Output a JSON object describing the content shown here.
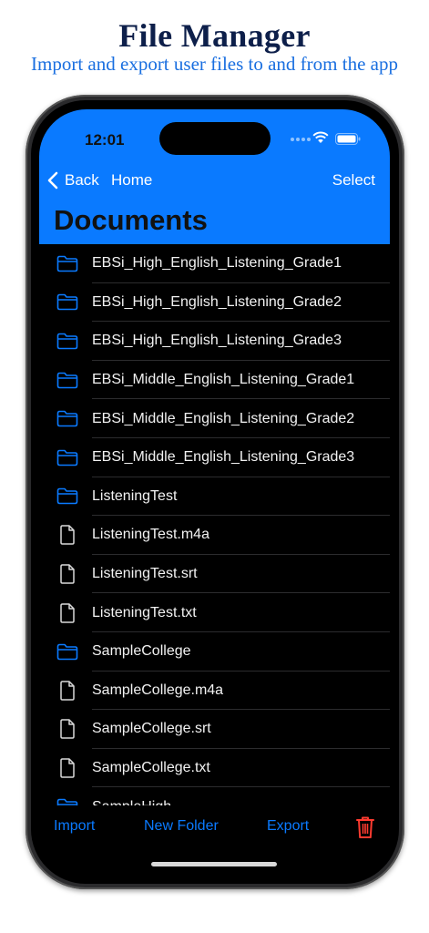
{
  "promo": {
    "title": "File Manager",
    "subtitle": "Import and export user files to and from the app"
  },
  "status_bar": {
    "time": "12:01",
    "icons": [
      "signal-icon",
      "wifi-icon",
      "battery-icon"
    ]
  },
  "nav": {
    "back_label": "Back",
    "home_label": "Home",
    "select_label": "Select",
    "title": "Documents"
  },
  "files": [
    {
      "name": "EBSi_High_English_Listening_Grade1",
      "type": "folder"
    },
    {
      "name": "EBSi_High_English_Listening_Grade2",
      "type": "folder"
    },
    {
      "name": "EBSi_High_English_Listening_Grade3",
      "type": "folder"
    },
    {
      "name": "EBSi_Middle_English_Listening_Grade1",
      "type": "folder"
    },
    {
      "name": "EBSi_Middle_English_Listening_Grade2",
      "type": "folder"
    },
    {
      "name": "EBSi_Middle_English_Listening_Grade3",
      "type": "folder"
    },
    {
      "name": "ListeningTest",
      "type": "folder"
    },
    {
      "name": "ListeningTest.m4a",
      "type": "file"
    },
    {
      "name": "ListeningTest.srt",
      "type": "file"
    },
    {
      "name": "ListeningTest.txt",
      "type": "file"
    },
    {
      "name": "SampleCollege",
      "type": "folder"
    },
    {
      "name": "SampleCollege.m4a",
      "type": "file"
    },
    {
      "name": "SampleCollege.srt",
      "type": "file"
    },
    {
      "name": "SampleCollege.txt",
      "type": "file"
    },
    {
      "name": "SampleHigh",
      "type": "folder"
    }
  ],
  "toolbar": {
    "import_label": "Import",
    "new_folder_label": "New Folder",
    "export_label": "Export",
    "delete_icon": "trash-icon"
  },
  "colors": {
    "accent": "#0a7aff",
    "header_bg": "#0a7aff",
    "delete": "#ff3b30",
    "background": "#000000",
    "row_text": "#f2f2f2",
    "promo_title": "#0d1f4a",
    "promo_subtitle": "#1a6fe0"
  }
}
